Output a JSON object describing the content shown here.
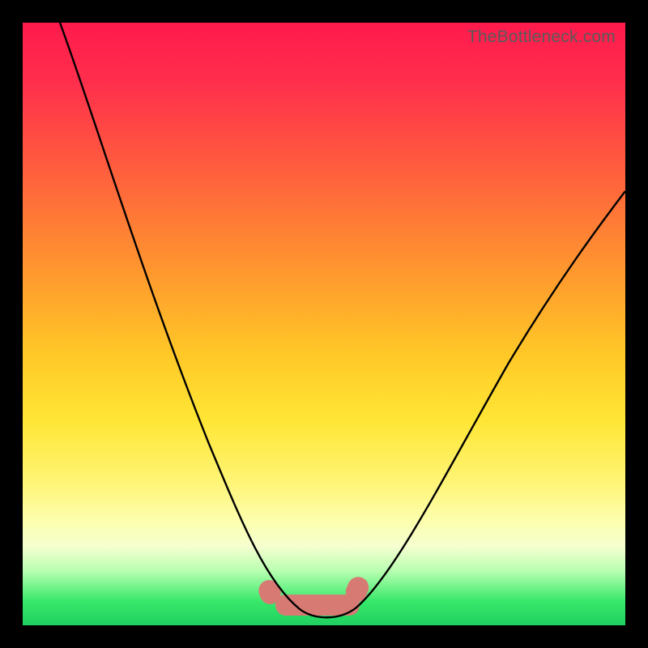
{
  "watermark": "TheBottleneck.com",
  "chart_data": {
    "type": "line",
    "title": "",
    "xlabel": "",
    "ylabel": "",
    "xlim": [
      0,
      100
    ],
    "ylim": [
      0,
      100
    ],
    "grid": false,
    "series": [
      {
        "name": "bottleneck-curve",
        "x": [
          6,
          10,
          15,
          20,
          25,
          30,
          34,
          37,
          40,
          43,
          45,
          48,
          52,
          55,
          58,
          62,
          68,
          75,
          82,
          90,
          98
        ],
        "values": [
          100,
          90,
          78,
          65,
          52,
          40,
          30,
          22,
          14,
          7,
          3,
          1,
          1,
          3,
          7,
          14,
          25,
          38,
          50,
          62,
          72
        ]
      }
    ],
    "annotations": [
      {
        "name": "highlight-band",
        "x_start": 40,
        "x_end": 56,
        "y": 2,
        "color": "#d87a74"
      }
    ],
    "background": {
      "gradient_stops": [
        {
          "pos": 0.0,
          "color": "#ff1a4d"
        },
        {
          "pos": 0.3,
          "color": "#ff7a35"
        },
        {
          "pos": 0.6,
          "color": "#ffe030"
        },
        {
          "pos": 0.85,
          "color": "#fbffc0"
        },
        {
          "pos": 1.0,
          "color": "#20d060"
        }
      ]
    }
  }
}
